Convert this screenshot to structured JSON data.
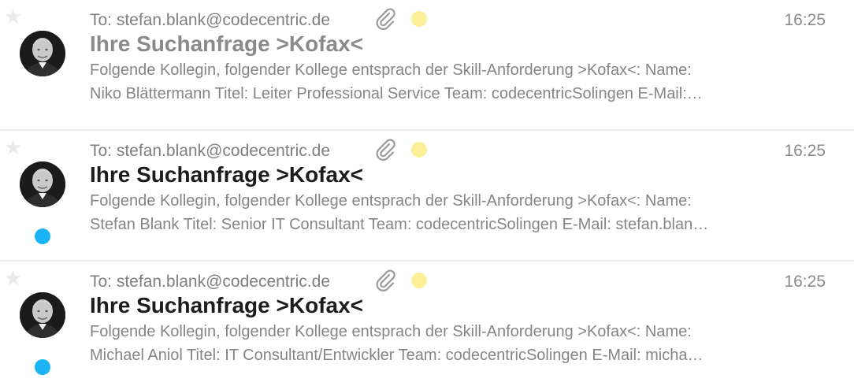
{
  "messages": [
    {
      "to": "To: stefan.blank@codecentric.de",
      "time": "16:25",
      "subject": "Ihre Suchanfrage >Kofax<",
      "preview_line1": "Folgende Kollegin, folgender Kollege entsprach der Skill-Anforderung >Kofax<: Name:",
      "preview_line2": "Niko Blättermann Titel: Leiter Professional Service Team: codecentricSolingen E-Mail:…",
      "unread": false,
      "has_attachment": true,
      "tag_color": "#fbf098"
    },
    {
      "to": "To: stefan.blank@codecentric.de",
      "time": "16:25",
      "subject": "Ihre Suchanfrage >Kofax<",
      "preview_line1": "Folgende Kollegin, folgender Kollege entsprach der Skill-Anforderung >Kofax<: Name:",
      "preview_line2": "Stefan Blank Titel: Senior IT Consultant Team: codecentricSolingen E-Mail: stefan.blan…",
      "unread": true,
      "has_attachment": true,
      "tag_color": "#fbf098"
    },
    {
      "to": "To: stefan.blank@codecentric.de",
      "time": "16:25",
      "subject": "Ihre Suchanfrage >Kofax<",
      "preview_line1": "Folgende Kollegin, folgender Kollege entsprach der Skill-Anforderung >Kofax<: Name:",
      "preview_line2": "Michael Aniol Titel: IT Consultant/Entwickler Team: codecentricSolingen E-Mail: micha…",
      "unread": true,
      "has_attachment": true,
      "tag_color": "#fbf098"
    }
  ],
  "colors": {
    "unread_dot": "#1ab4f5",
    "tag_yellow": "#fbf098",
    "star": "#e9e9e9",
    "separator": "#ececec"
  },
  "icons": [
    "star-icon",
    "avatar",
    "paperclip-icon",
    "unread-dot",
    "tag-dot"
  ]
}
